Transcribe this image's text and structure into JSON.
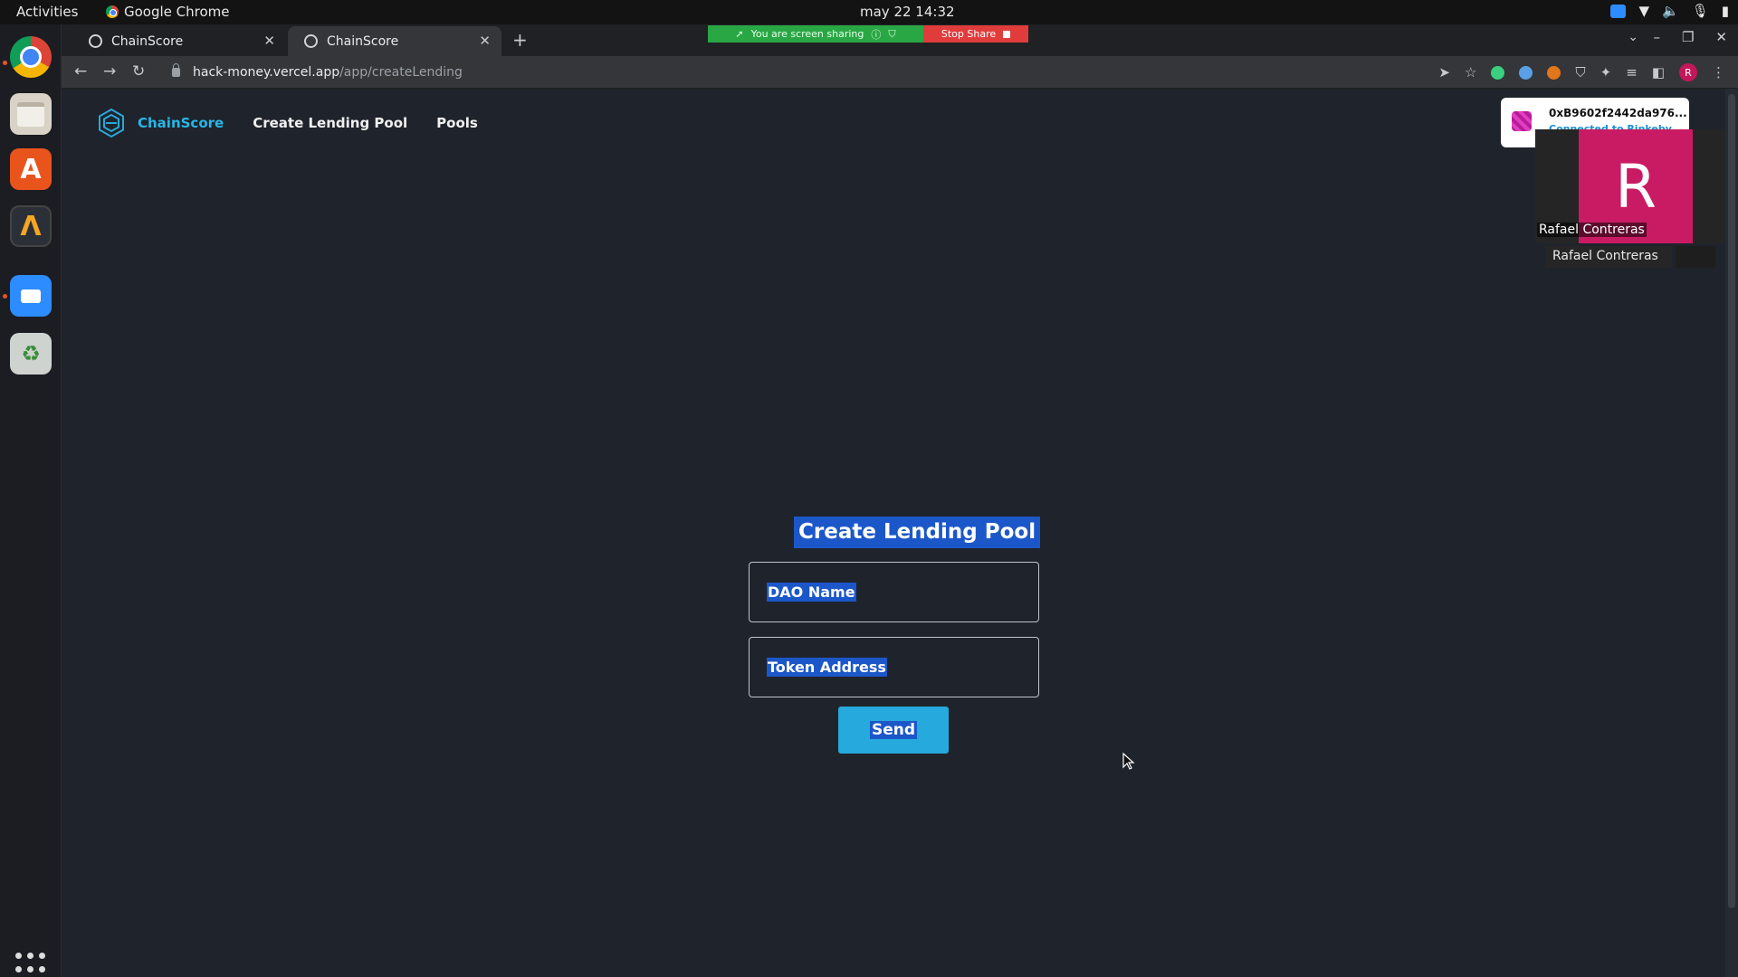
{
  "system": {
    "activities": "Activities",
    "app_name": "Google Chrome",
    "clock": "may 22  14:32"
  },
  "browser": {
    "tabs": [
      {
        "title": "ChainScore"
      },
      {
        "title": "ChainScore"
      }
    ],
    "url_host": "hack-money.vercel.app",
    "url_path": "/app/createLending"
  },
  "screen_share": {
    "status": "You are screen sharing",
    "stop_label": "Stop Share"
  },
  "site": {
    "brand": "ChainScore",
    "nav": {
      "create_lending_pool": "Create Lending Pool",
      "pools": "Pools"
    },
    "wallet": {
      "address": "0xB9602f2442da976...",
      "network": "Connected to Rinkeby"
    }
  },
  "zoom": {
    "initial": "R",
    "name": "Rafael Contreras",
    "name_tag": "Rafael Contreras"
  },
  "form": {
    "title": "Create Lending Pool",
    "dao_placeholder": "DAO Name",
    "token_placeholder": "Token Address",
    "send_label": "Send"
  },
  "colors": {
    "accent": "#29b6e6",
    "button": "#26a9dc",
    "selection": "#1c57c9",
    "background": "#1f232b"
  }
}
